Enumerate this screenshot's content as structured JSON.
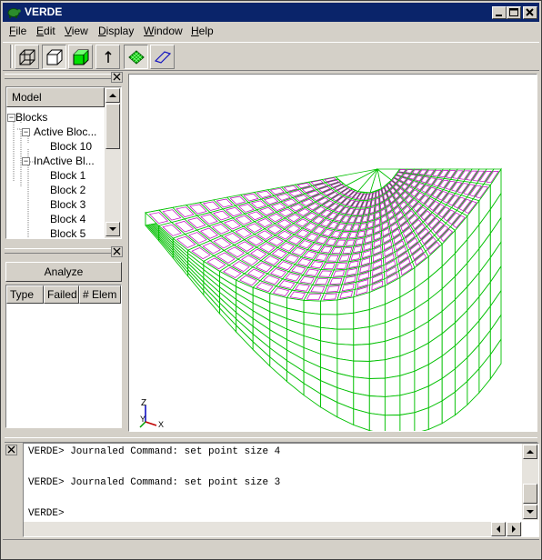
{
  "window": {
    "title": "VERDE"
  },
  "menu": [
    {
      "label": "File",
      "key": "F",
      "rest": "ile"
    },
    {
      "label": "Edit",
      "key": "E",
      "rest": "dit"
    },
    {
      "label": "View",
      "key": "V",
      "rest": "iew"
    },
    {
      "label": "Display",
      "key": "D",
      "rest": "isplay"
    },
    {
      "label": "Window",
      "key": "W",
      "rest": "indow"
    },
    {
      "label": "Help",
      "key": "H",
      "rest": "elp"
    }
  ],
  "toolbar": {
    "icons": [
      "wireframe-icon",
      "hidden-line-icon",
      "smooth-shade-icon",
      "point-icon",
      "mesh-element-icon",
      "surface-outline-icon"
    ]
  },
  "model_panel": {
    "header": "Model",
    "tree": [
      {
        "label": "Blocks",
        "level": 0,
        "expanded": true
      },
      {
        "label": "Active Bloc...",
        "level": 1,
        "expanded": true
      },
      {
        "label": "Block 10",
        "level": 2
      },
      {
        "label": "InActive Bl...",
        "level": 1,
        "expanded": true
      },
      {
        "label": "Block 1",
        "level": 2
      },
      {
        "label": "Block 2",
        "level": 2
      },
      {
        "label": "Block 3",
        "level": 2
      },
      {
        "label": "Block 4",
        "level": 2
      },
      {
        "label": "Block 5",
        "level": 2
      }
    ]
  },
  "analyze_panel": {
    "button": "Analyze",
    "columns": [
      "Type",
      "Failed",
      "# Elem"
    ]
  },
  "viewport": {
    "axes": {
      "z": "Z",
      "y": "Y",
      "x": "X"
    },
    "colors": {
      "mesh_edges": "#00c000",
      "elements": "#c000c0"
    }
  },
  "console": {
    "lines": [
      "VERDE> Journaled Command: set point size 4",
      "",
      "VERDE> Journaled Command: set point size 3",
      "",
      "VERDE> "
    ]
  }
}
